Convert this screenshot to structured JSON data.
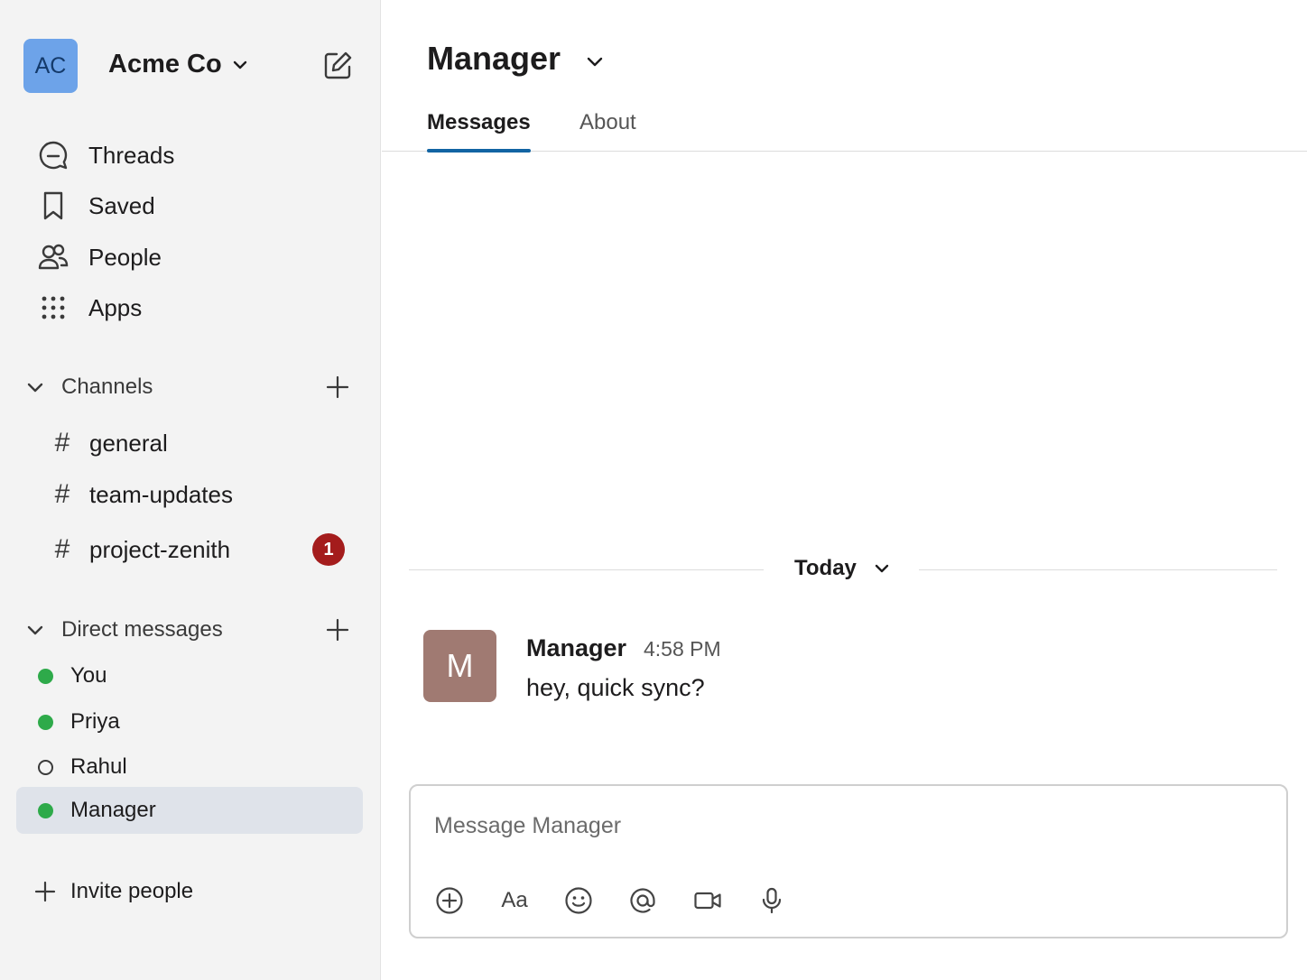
{
  "workspace": {
    "initials": "AC",
    "name": "Acme Co"
  },
  "nav": [
    {
      "label": "Threads",
      "icon": "threads-icon"
    },
    {
      "label": "Saved",
      "icon": "bookmark-icon"
    },
    {
      "label": "People",
      "icon": "people-icon"
    },
    {
      "label": "Apps",
      "icon": "apps-grid-icon"
    }
  ],
  "channels": {
    "heading": "Channels",
    "items": [
      {
        "name": "general"
      },
      {
        "name": "team-updates"
      },
      {
        "name": "project-zenith",
        "unread": "1"
      }
    ]
  },
  "dms": {
    "heading": "Direct messages",
    "items": [
      {
        "name": "You",
        "status": "online"
      },
      {
        "name": "Priya",
        "status": "online"
      },
      {
        "name": "Rahul",
        "status": "away"
      },
      {
        "name": "Manager",
        "status": "online",
        "active": true
      }
    ]
  },
  "invite_label": "Invite people",
  "conversation": {
    "title": "Manager",
    "tabs": [
      "Messages",
      "About"
    ],
    "active_tab": "Messages",
    "day_divider": "Today",
    "messages": [
      {
        "avatar": "M",
        "author": "Manager",
        "time": "4:58 PM",
        "text": "hey, quick sync?",
        "avatar_color": "#a07a72"
      }
    ]
  },
  "composer": {
    "placeholder": "Message Manager",
    "value": "",
    "format_label": "Aa"
  },
  "colors": {
    "accent": "#1264a3",
    "online": "#2eaa4a",
    "badge": "#a41c1c",
    "workspace_avatar": "#6da3e9"
  }
}
